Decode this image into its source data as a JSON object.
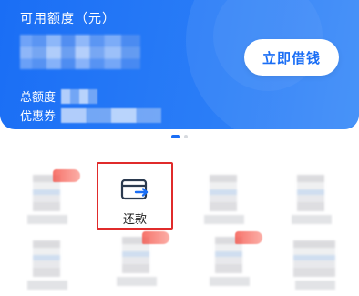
{
  "loan_card": {
    "title": "可用额度（元）",
    "borrow_button": "立即借钱",
    "total_limit_label": "总额度",
    "coupon_label": "优惠券"
  },
  "carousel": {
    "page_count": 2,
    "active_index": 0
  },
  "shortcuts": {
    "repay": {
      "label": "还款",
      "icon": "card-repay-icon",
      "highlight_color": "#e02b2b"
    }
  },
  "colors": {
    "brand_blue": "#1a6ef5",
    "card_text": "#ffffff"
  }
}
